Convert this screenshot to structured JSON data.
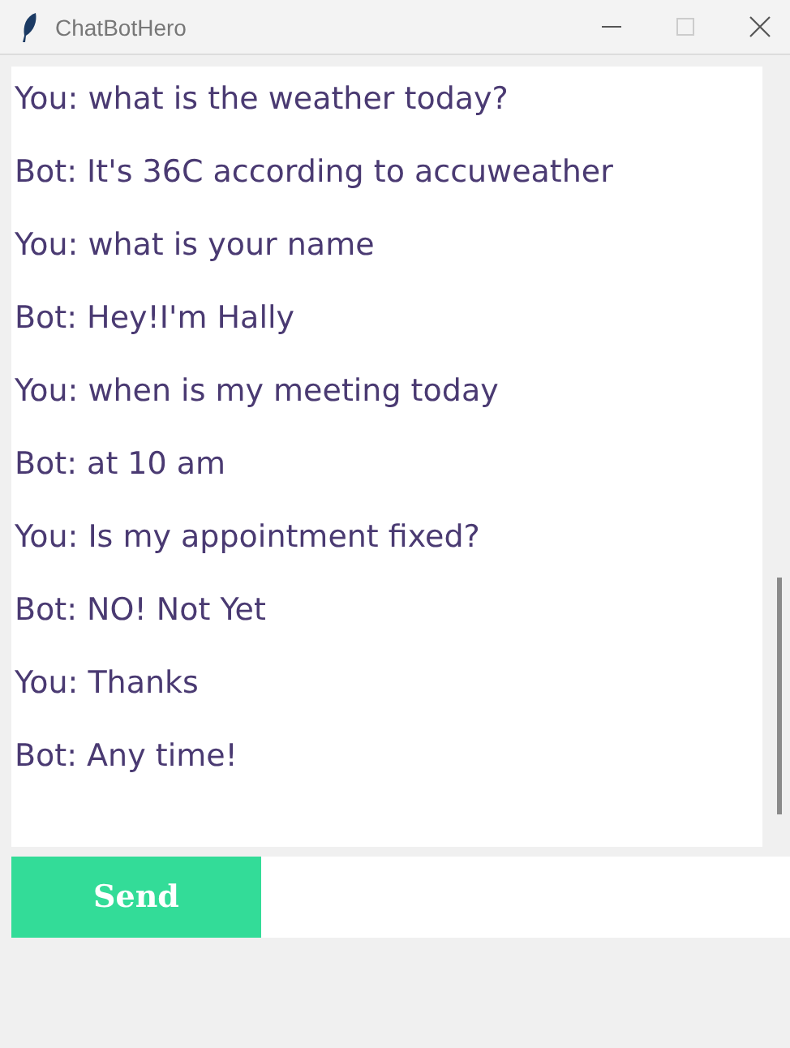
{
  "window": {
    "title": "ChatBotHero"
  },
  "messages": [
    "You: what is the weather today?",
    "Bot: It's 36C according to accuweather",
    "You: what is your name",
    "Bot: Hey!I'm Hally",
    "You: when is my meeting today",
    "Bot: at 10 am",
    "You: Is my appointment fixed?",
    "Bot: NO! Not Yet",
    "You: Thanks",
    "Bot: Any time!"
  ],
  "send_button": {
    "label": "Send"
  }
}
